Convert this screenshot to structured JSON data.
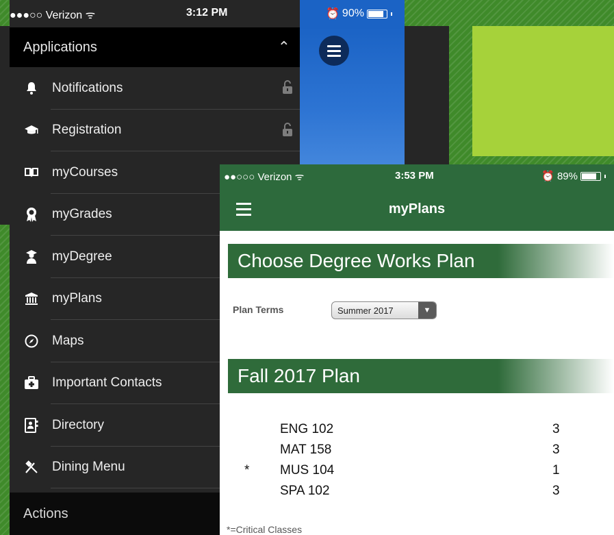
{
  "left_phone": {
    "status": {
      "carrier": "●●●○○ Verizon",
      "time": "3:12 PM",
      "battery": "90%",
      "battery_level": 0.9
    },
    "menu": {
      "header": "Applications",
      "items": [
        {
          "label": "Notifications",
          "icon": "bell-icon",
          "locked": true
        },
        {
          "label": "Registration",
          "icon": "graduation-cap-icon",
          "locked": true
        },
        {
          "label": "myCourses",
          "icon": "book-icon",
          "locked": true
        },
        {
          "label": "myGrades",
          "icon": "award-ribbon-icon",
          "locked": false
        },
        {
          "label": "myDegree",
          "icon": "graduate-person-icon",
          "locked": false
        },
        {
          "label": "myPlans",
          "icon": "institution-icon",
          "locked": false
        },
        {
          "label": "Maps",
          "icon": "compass-icon",
          "locked": false
        },
        {
          "label": "Important Contacts",
          "icon": "first-aid-kit-icon",
          "locked": false
        },
        {
          "label": "Directory",
          "icon": "address-book-icon",
          "locked": false
        },
        {
          "label": "Dining Menu",
          "icon": "fork-knife-icon",
          "locked": false
        }
      ],
      "actions_header": "Actions"
    }
  },
  "right_phone": {
    "status": {
      "carrier": "●●○○○ Verizon",
      "time": "3:53 PM",
      "battery": "89%",
      "battery_level": 0.89
    },
    "nav_title": "myPlans",
    "section1_title": "Choose Degree Works Plan",
    "plan_terms_label": "Plan Terms",
    "plan_terms_value": "Summer 2017",
    "section2_title": "Fall 2017 Plan",
    "courses": [
      {
        "mark": "",
        "code": "ENG 102",
        "credits": "3"
      },
      {
        "mark": "",
        "code": "MAT 158",
        "credits": "3"
      },
      {
        "mark": "*",
        "code": "MUS 104",
        "credits": "1"
      },
      {
        "mark": "",
        "code": "SPA 102",
        "credits": "3"
      }
    ],
    "footnote": "*=Critical Classes"
  },
  "colors": {
    "green_bar": "#2d6a3c",
    "lime": "#a6d23a",
    "blue": "#1b63c5",
    "menu_bg": "#262626"
  }
}
